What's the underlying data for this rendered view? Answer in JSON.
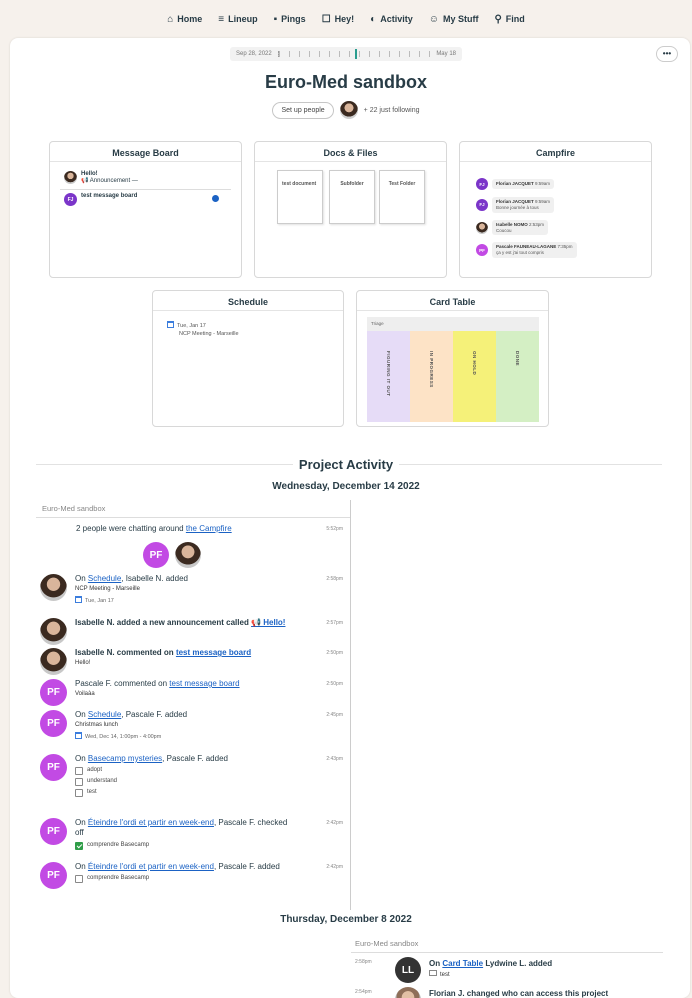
{
  "nav": [
    {
      "label": "Home",
      "icon": "home-icon"
    },
    {
      "label": "Lineup",
      "icon": "lineup-icon"
    },
    {
      "label": "Pings",
      "icon": "pings-icon"
    },
    {
      "label": "Hey!",
      "icon": "hey-icon"
    },
    {
      "label": "Activity",
      "icon": "activity-icon"
    },
    {
      "label": "My Stuff",
      "icon": "my-stuff-icon"
    },
    {
      "label": "Find",
      "icon": "find-icon"
    }
  ],
  "timeline": {
    "start": "Sep 28, 2022",
    "end": "May 18"
  },
  "project": {
    "title": "Euro-Med sandbox",
    "setup_label": "Set up people",
    "following": "+ 22 just following"
  },
  "message_board": {
    "title": "Message Board",
    "items": [
      {
        "title": "Hello!",
        "sub": "📢 Announcement —"
      },
      {
        "title": "test message board",
        "initials": "FJ"
      }
    ]
  },
  "docs": {
    "title": "Docs & Files",
    "cards": [
      {
        "text": "test document"
      },
      {
        "text": "Subfolder"
      },
      {
        "text": "Test Folder"
      }
    ]
  },
  "campfire": {
    "title": "Campfire",
    "lines": [
      {
        "initials": "FJ",
        "name": "Florian JACQUET",
        "time": "9:59am",
        "text": ""
      },
      {
        "initials": "FJ",
        "name": "Florian JACQUET",
        "time": "9:59am",
        "text": "Bonne journée à tous"
      },
      {
        "initials": "",
        "name": "Isabelle NOMO",
        "time": "2:53pm",
        "text": "Coucou"
      },
      {
        "initials": "PF",
        "name": "Pascale FAUNEAU-LAGANE",
        "time": "7:35pm",
        "text": "ça y est j'ai tout compris"
      }
    ]
  },
  "schedule": {
    "title": "Schedule",
    "date": "Tue, Jan 17",
    "event": "NCP Meeting - Marseille"
  },
  "card_table": {
    "title": "Card Table",
    "triage": "Triage",
    "columns": [
      "FIGURING IT OUT",
      "IN PROGRESS",
      "ON HOLD",
      "DONE"
    ]
  },
  "activity": {
    "heading": "Project Activity",
    "day1": "Wednesday, December 14 2022",
    "stream_label": "Euro-Med sandbox",
    "campfire_event": {
      "text": "2 people were chatting around",
      "link": "the Campfire",
      "time": "5:52pm",
      "initials": "PF"
    },
    "events": [
      {
        "initials": "",
        "main_pre": "On",
        "link": "Schedule",
        "main_post": ", Isabelle N. added",
        "sub": "NCP Meeting - Marseille",
        "sub2": "Tue, Jan 17",
        "time": "2:58pm"
      },
      {
        "initials": "",
        "main_pre": "Isabelle N. added a new announcement called",
        "link": "📢 Hello!",
        "main_post": "",
        "sub": "",
        "sub2": "",
        "time": "2:57pm"
      },
      {
        "initials": "",
        "main_pre": "Isabelle N. commented on",
        "link": "test message board",
        "main_post": "",
        "sub": "Hello!",
        "sub2": "",
        "time": "2:50pm"
      },
      {
        "initials": "PF",
        "main_pre": "Pascale F. commented on",
        "link": "test message board",
        "main_post": "",
        "sub": "Voilaàa",
        "sub2": "",
        "time": "2:50pm"
      },
      {
        "initials": "PF",
        "main_pre": "On",
        "link": "Schedule",
        "main_post": ", Pascale F. added",
        "sub": "Christmas lunch",
        "sub2": "Wed, Dec 14, 1:00pm - 4:00pm",
        "time": "2:45pm"
      },
      {
        "initials": "PF",
        "main_pre": "On",
        "link": "Basecamp mysteries",
        "main_post": ", Pascale F. added",
        "checks": [
          "adopt",
          "understand",
          "test"
        ],
        "time": "2:43pm"
      },
      {
        "initials": "PF",
        "main_pre": "On",
        "link": "Éteindre l'ordi et partir en week-end",
        "main_post": ", Pascale F. checked off",
        "checks_on": [
          "comprendre Basecamp"
        ],
        "time": "2:42pm"
      },
      {
        "initials": "PF",
        "main_pre": "On",
        "link": "Éteindre l'ordi et partir en week-end",
        "main_post": ", Pascale F. added",
        "checks": [
          "comprendre Basecamp"
        ],
        "time": "2:42pm"
      }
    ],
    "day2": "Thursday, December 8 2022",
    "stream2_label": "Euro-Med sandbox",
    "events2": [
      {
        "initials": "LL",
        "time": "2:58pm",
        "main_pre": "On",
        "link": "Card Table",
        "main_post": " Lydwine L. added",
        "sub": "test"
      },
      {
        "initials": "",
        "time": "2:54pm",
        "main_pre": "Florian J. changed who can access this project",
        "link": "",
        "main_post": "",
        "sub": ""
      }
    ]
  }
}
